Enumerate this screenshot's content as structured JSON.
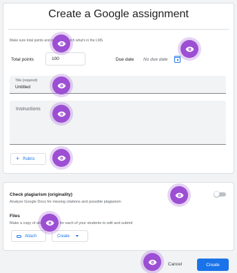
{
  "dialog": {
    "title": "Create a Google assignment",
    "helper_text": "Make sure total points and due date match what's in the LMS",
    "total_points_label": "Total points",
    "total_points_value": "100",
    "due_date_label": "Due date",
    "due_date_value": "No due date",
    "title_field_label": "Title (required)",
    "title_field_value": "Untitled",
    "instructions_placeholder": "Instructions",
    "rubric_label": "Rubric"
  },
  "options": {
    "plagiarism_title": "Check plagiarism (originality)",
    "plagiarism_subtitle": "Analyze Google Docs for missing citations and possible plagiarism",
    "plagiarism_enabled": false,
    "files_title": "Files",
    "files_subtitle": "Make a copy of attached files for each of your students to edit and submit",
    "attach_label": "Attach",
    "create_label": "Create"
  },
  "footer": {
    "cancel_label": "Cancel",
    "create_label": "Create"
  },
  "colors": {
    "accent": "#1a73e8",
    "overlay_marker": "#9c4fd3"
  },
  "icons": {
    "calendar": "calendar-icon",
    "plus": "plus-icon",
    "attach": "paperclip-icon",
    "dropdown": "caret-down-icon",
    "overlay": "eye-icon"
  }
}
